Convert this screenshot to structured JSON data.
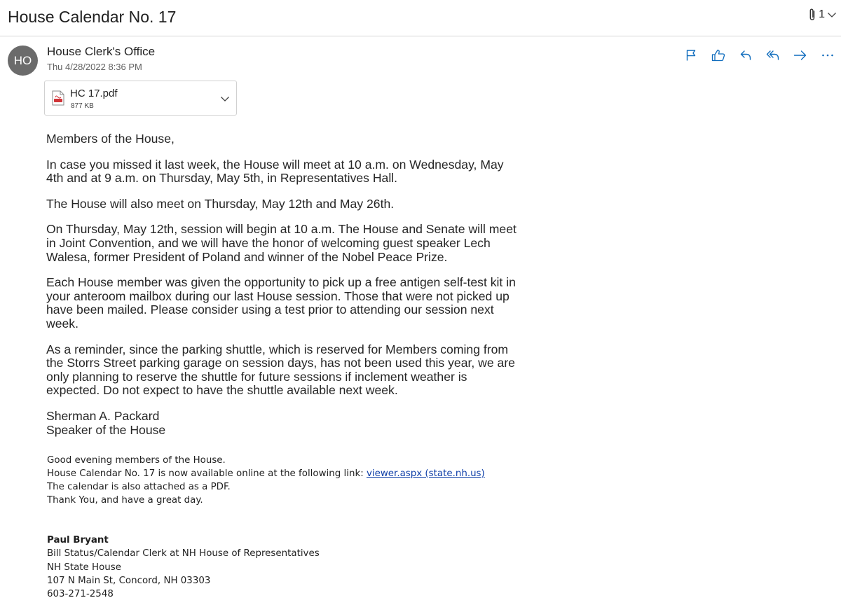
{
  "subject": "House Calendar No. 17",
  "attachment_count": "1",
  "sender": {
    "initials": "HO",
    "name": "House Clerk's Office",
    "date": "Thu 4/28/2022 8:36 PM"
  },
  "actions": [
    "flag-icon",
    "like-icon",
    "reply-icon",
    "reply-all-icon",
    "forward-icon",
    "more-icon"
  ],
  "attachment": {
    "name": "HC 17.pdf",
    "size": "877 KB"
  },
  "message": {
    "greeting": "Members of the House,",
    "p1": "In case you missed it last week, the House will meet at 10 a.m. on Wednesday, May 4th and at 9 a.m. on Thursday, May 5th, in Representatives Hall.",
    "p2": "The House will also meet on Thursday, May 12th and May 26th.",
    "p3": "On Thursday, May 12th, session will begin at 10 a.m. The House and Senate will meet in Joint Convention, and we will have the honor of welcoming guest speaker Lech Walesa, former President of Poland and winner of the Nobel Peace Prize.",
    "p4": "Each House member was given the opportunity to pick up a free antigen self-test kit in your anteroom mailbox during our last House session. Those that were not picked up have been mailed. Please consider using a test prior to attending our session next week.",
    "p5": "As a reminder, since the parking shuttle, which is reserved for Members coming from the Storrs Street parking garage on session days, has not been used this year, we are only planning to reserve the shuttle for future sessions if inclement weather is expected. Do not expect to have the shuttle available next week.",
    "closing_name": "Sherman A. Packard",
    "closing_title": "Speaker of the House"
  },
  "note": {
    "line1": "Good evening members of the House.",
    "line2_prefix": "House Calendar No. 17 is now available online at the following link: ",
    "link_text": "viewer.aspx (state.nh.us)",
    "line3": "The calendar is also attached as a PDF.",
    "line4": "Thank You, and have a great day."
  },
  "signature": {
    "name": "Paul Bryant",
    "title": "Bill Status/Calendar Clerk at NH House of Representatives",
    "org": "NH State House",
    "address": "107 N Main St, Concord, NH 03303",
    "phone": "603-271-2548"
  },
  "colors": {
    "accent": "#0f6cbd",
    "link": "#0f3fa8",
    "avatar": "#6b6b6b"
  }
}
